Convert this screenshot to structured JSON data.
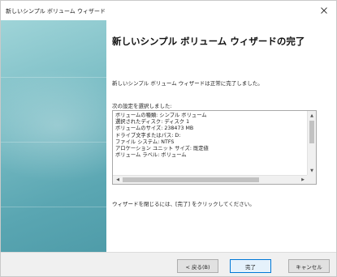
{
  "window": {
    "title": "新しいシンプル ボリューム ウィザード"
  },
  "page": {
    "heading": "新しいシンプル ボリューム ウィザードの完了",
    "description": "新しいシンプル ボリューム ウィザードは正常に完了しました。",
    "settings_label": "次の設定を選択しました:",
    "settings": [
      "ボリュームの種類: シンプル ボリューム",
      "選択されたディスク: ディスク 1",
      "ボリュームのサイズ: 238473 MB",
      "ドライブ文字またはパス: D:",
      "ファイル システム: NTFS",
      "アロケーション ユニット サイズ: 既定値",
      "ボリューム ラベル: ボリューム"
    ],
    "finish_hint": "ウィザードを閉じるには、[完了] をクリックしてください。"
  },
  "buttons": {
    "back": "< 戻る(B)",
    "finish": "完了",
    "cancel": "キャンセル"
  },
  "icons": {
    "close": "close-icon",
    "scroll_up": "scroll-up-icon",
    "scroll_down": "scroll-down-icon",
    "scroll_left": "scroll-left-icon",
    "scroll_right": "scroll-right-icon"
  },
  "colors": {
    "side_panel": "#79bcc4",
    "primary_button_border": "#0078d7"
  }
}
